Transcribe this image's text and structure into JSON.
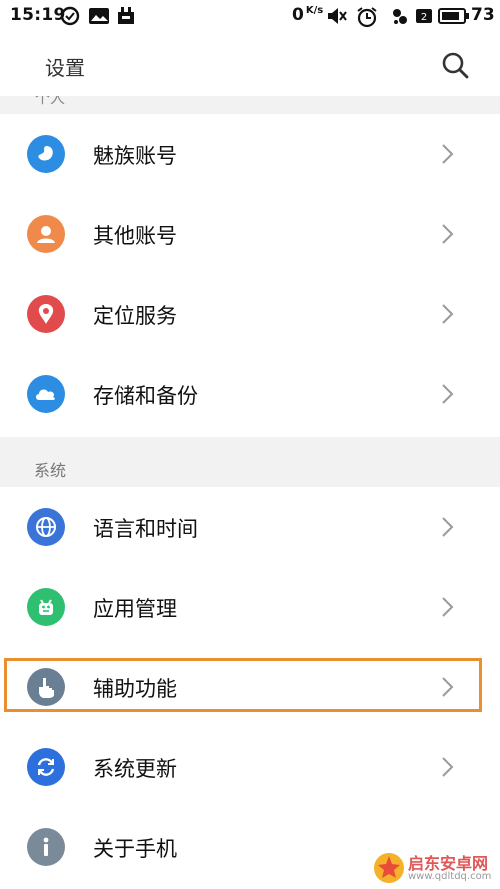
{
  "status_bar": {
    "time": "15:19",
    "net_rate": "0",
    "net_rate_unit": "K/s",
    "battery": "73"
  },
  "header": {
    "title": "设置",
    "search_icon": "search-icon"
  },
  "cut_section_label": "个人",
  "accounts": [
    {
      "label": "魅族账号",
      "icon": "flyme-account-icon",
      "color": "#2d8de3"
    },
    {
      "label": "其他账号",
      "icon": "person-icon",
      "color": "#f08a4b"
    },
    {
      "label": "定位服务",
      "icon": "location-pin-icon",
      "color": "#e14b4b"
    },
    {
      "label": "存储和备份",
      "icon": "cloud-icon",
      "color": "#2d8de3"
    }
  ],
  "system_section": {
    "title": "系统",
    "items": [
      {
        "label": "语言和时间",
        "icon": "globe-icon",
        "color": "#3a74d8"
      },
      {
        "label": "应用管理",
        "icon": "android-icon",
        "color": "#2fbf71"
      },
      {
        "label": "辅助功能",
        "icon": "hand-pointer-icon",
        "color": "#6a7f94",
        "highlighted": true
      },
      {
        "label": "系统更新",
        "icon": "refresh-icon",
        "color": "#2d6fdc"
      },
      {
        "label": "关于手机",
        "icon": "info-icon",
        "color": "#7a8a99"
      }
    ]
  },
  "watermark": {
    "name": "启东安卓网",
    "url": "www.qdltdq.com"
  },
  "colors": {
    "highlight": "#e8902f",
    "divider_bg": "#f2f2f2"
  }
}
